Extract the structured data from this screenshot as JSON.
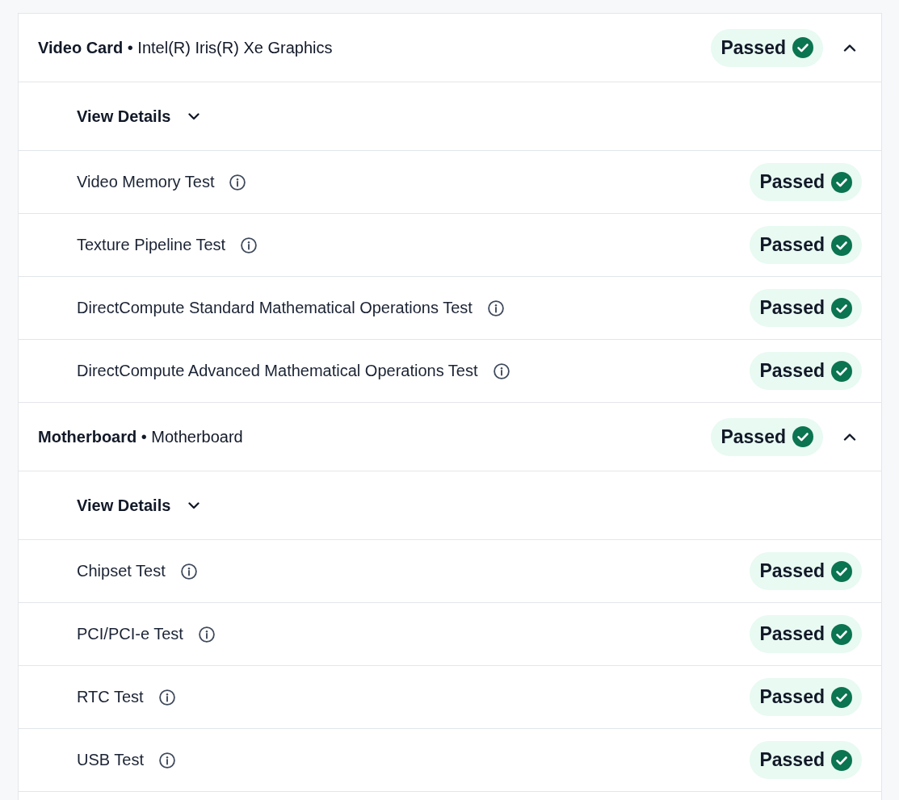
{
  "sections": [
    {
      "title": "**Video Card** • Intel(R) Iris(R) Xe Graphics",
      "status": {
        "label": "Passed",
        "kind": "passed"
      },
      "expanded": true,
      "details": {
        "label": "View Details",
        "expanded": false
      },
      "tests": [
        {
          "name": "Video Memory Test",
          "status": {
            "label": "Passed",
            "kind": "passed"
          }
        },
        {
          "name": "Texture Pipeline Test",
          "status": {
            "label": "Passed",
            "kind": "passed"
          }
        },
        {
          "name": "DirectCompute Standard Mathematical Operations Test",
          "status": {
            "label": "Passed",
            "kind": "passed"
          }
        },
        {
          "name": "DirectCompute Advanced Mathematical Operations Test",
          "status": {
            "label": "Passed",
            "kind": "passed"
          }
        }
      ]
    },
    {
      "title": "**Motherboard** • Motherboard",
      "status": {
        "label": "Passed",
        "kind": "passed"
      },
      "expanded": true,
      "details": {
        "label": "View Details",
        "expanded": false
      },
      "tests": [
        {
          "name": "Chipset Test",
          "status": {
            "label": "Passed",
            "kind": "passed"
          }
        },
        {
          "name": "PCI/PCI-e Test",
          "status": {
            "label": "Passed",
            "kind": "passed"
          }
        },
        {
          "name": "RTC Test",
          "status": {
            "label": "Passed",
            "kind": "passed"
          }
        },
        {
          "name": "USB Test",
          "status": {
            "label": "Passed",
            "kind": "passed"
          }
        }
      ]
    }
  ]
}
